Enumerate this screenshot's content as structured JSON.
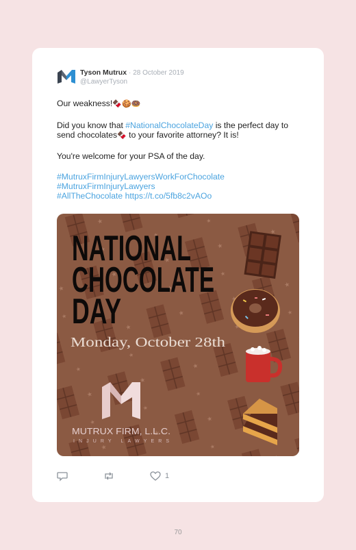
{
  "tweet": {
    "author_name": "Tyson Mutrux",
    "separator": "·",
    "date": "28 October 2019",
    "handle": "@LawyerTyson",
    "line1": "Our weakness!",
    "line1_emoji": "🍫🍪🍩",
    "para2_a": "Did you know that ",
    "para2_hashtag": "#NationalChocolateDay",
    "para2_b": " is the perfect day to send chocolates",
    "para2_emoji": "🍫",
    "para2_c": " to your favorite attorney? It is!",
    "line3": "You're welcome for your PSA of the day.",
    "hashtag1": "#MutruxFirmInjuryLawyersWorkForChocolate",
    "hashtag2": "#MutruxFirmInjuryLawyers",
    "hashtag3": "#AllTheChocolate",
    "link": "https://t.co/5fb8c2vAOo",
    "like_count": "1"
  },
  "image": {
    "title_line1": "NATIONAL",
    "title_line2": "CHOCOLATE",
    "title_line3": "DAY",
    "date_text": "Monday, October 28th",
    "firm_name": "MUTRUX FIRM, L.L.C.",
    "firm_sub": "INJURY LAWYERS"
  },
  "page_number": "70",
  "colors": {
    "page_bg": "#f6e3e4",
    "card_bg": "#ffffff",
    "link_blue": "#4aa3df",
    "image_bg": "#8b5a43"
  }
}
